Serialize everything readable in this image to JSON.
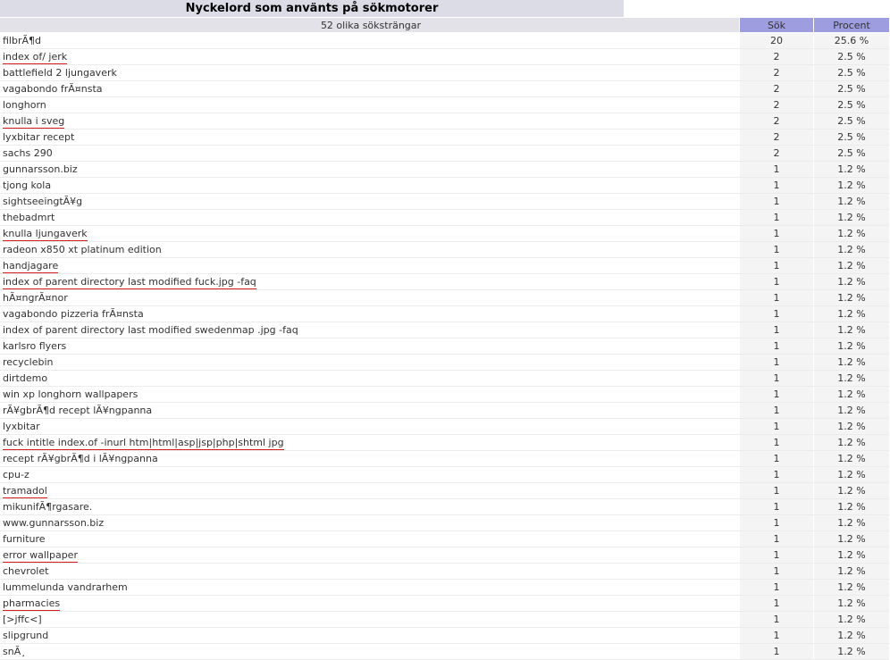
{
  "title": "Nyckelord som använts på sökmotorer",
  "header": {
    "keyword": "52 olika söksträngar",
    "count": "Sök",
    "percent": "Procent"
  },
  "rows": [
    {
      "keyword": "filbrÃ¶d",
      "count": "20",
      "percent": "25.6 %",
      "underline": false
    },
    {
      "keyword": "index of/ jerk",
      "count": "2",
      "percent": "2.5 %",
      "underline": true
    },
    {
      "keyword": "battlefield 2 ljungaverk",
      "count": "2",
      "percent": "2.5 %",
      "underline": false
    },
    {
      "keyword": "vagabondo frÃ¤nsta",
      "count": "2",
      "percent": "2.5 %",
      "underline": false
    },
    {
      "keyword": "longhorn",
      "count": "2",
      "percent": "2.5 %",
      "underline": false
    },
    {
      "keyword": "knulla i sveg",
      "count": "2",
      "percent": "2.5 %",
      "underline": true
    },
    {
      "keyword": "lyxbitar recept",
      "count": "2",
      "percent": "2.5 %",
      "underline": false
    },
    {
      "keyword": "sachs 290",
      "count": "2",
      "percent": "2.5 %",
      "underline": false
    },
    {
      "keyword": "gunnarsson.biz",
      "count": "1",
      "percent": "1.2 %",
      "underline": false
    },
    {
      "keyword": "tjong kola",
      "count": "1",
      "percent": "1.2 %",
      "underline": false
    },
    {
      "keyword": "sightseeingtÃ¥g",
      "count": "1",
      "percent": "1.2 %",
      "underline": false
    },
    {
      "keyword": "thebadmrt",
      "count": "1",
      "percent": "1.2 %",
      "underline": false
    },
    {
      "keyword": "knulla ljungaverk",
      "count": "1",
      "percent": "1.2 %",
      "underline": true
    },
    {
      "keyword": "radeon x850 xt platinum edition",
      "count": "1",
      "percent": "1.2 %",
      "underline": false
    },
    {
      "keyword": "handjagare",
      "count": "1",
      "percent": "1.2 %",
      "underline": true
    },
    {
      "keyword": "index of parent directory last modified fuck.jpg -faq",
      "count": "1",
      "percent": "1.2 %",
      "underline": true
    },
    {
      "keyword": "hÃ¤ngrÃ¤nor",
      "count": "1",
      "percent": "1.2 %",
      "underline": false
    },
    {
      "keyword": "vagabondo pizzeria frÃ¤nsta",
      "count": "1",
      "percent": "1.2 %",
      "underline": false
    },
    {
      "keyword": "index of parent directory last modified swedenmap .jpg -faq",
      "count": "1",
      "percent": "1.2 %",
      "underline": false
    },
    {
      "keyword": "karlsro flyers",
      "count": "1",
      "percent": "1.2 %",
      "underline": false
    },
    {
      "keyword": "recyclebin",
      "count": "1",
      "percent": "1.2 %",
      "underline": false
    },
    {
      "keyword": "dirtdemo",
      "count": "1",
      "percent": "1.2 %",
      "underline": false
    },
    {
      "keyword": "win xp longhorn wallpapers",
      "count": "1",
      "percent": "1.2 %",
      "underline": false
    },
    {
      "keyword": "rÃ¥gbrÃ¶d recept lÃ¥ngpanna",
      "count": "1",
      "percent": "1.2 %",
      "underline": false
    },
    {
      "keyword": "lyxbitar",
      "count": "1",
      "percent": "1.2 %",
      "underline": false
    },
    {
      "keyword": "fuck intitle index.of -inurl htm|html|asp|jsp|php|shtml jpg",
      "count": "1",
      "percent": "1.2 %",
      "underline": true
    },
    {
      "keyword": "recept rÃ¥gbrÃ¶d i lÃ¥ngpanna",
      "count": "1",
      "percent": "1.2 %",
      "underline": false
    },
    {
      "keyword": "cpu-z",
      "count": "1",
      "percent": "1.2 %",
      "underline": false
    },
    {
      "keyword": "tramadol",
      "count": "1",
      "percent": "1.2 %",
      "underline": true
    },
    {
      "keyword": "mikunifÃ¶rgasare.",
      "count": "1",
      "percent": "1.2 %",
      "underline": false
    },
    {
      "keyword": "www.gunnarsson.biz",
      "count": "1",
      "percent": "1.2 %",
      "underline": false
    },
    {
      "keyword": "furniture",
      "count": "1",
      "percent": "1.2 %",
      "underline": false
    },
    {
      "keyword": "error wallpaper",
      "count": "1",
      "percent": "1.2 %",
      "underline": true
    },
    {
      "keyword": "chevrolet",
      "count": "1",
      "percent": "1.2 %",
      "underline": false
    },
    {
      "keyword": "lummelunda vandrarhem",
      "count": "1",
      "percent": "1.2 %",
      "underline": false
    },
    {
      "keyword": "pharmacies",
      "count": "1",
      "percent": "1.2 %",
      "underline": true
    },
    {
      "keyword": "[>jffc<]",
      "count": "1",
      "percent": "1.2 %",
      "underline": false
    },
    {
      "keyword": "slipgrund",
      "count": "1",
      "percent": "1.2 %",
      "underline": false
    },
    {
      "keyword": "snÃ¸",
      "count": "1",
      "percent": "1.2 %",
      "underline": false
    }
  ]
}
